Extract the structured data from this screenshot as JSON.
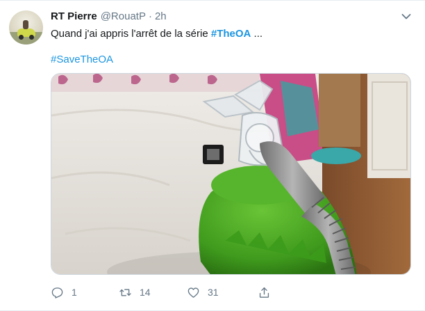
{
  "tweet": {
    "author_name": "RT Pierre",
    "author_handle": "@RouatP",
    "separator": "·",
    "timestamp": "2h",
    "text_before": "Quand j'ai appris l'arrêt de la série ",
    "hashtag_inline": "#TheOA",
    "text_after": " ...",
    "hashtag_line": "#SaveTheOA",
    "media_alt": "",
    "actions": {
      "reply_count": "1",
      "retweet_count": "14",
      "like_count": "31"
    }
  },
  "icons": {
    "menu": "chevron-down-icon",
    "reply": "reply-icon",
    "retweet": "retweet-icon",
    "like": "heart-icon",
    "share": "share-icon"
  },
  "colors": {
    "accent": "#1b95e0",
    "muted": "#657786",
    "text": "#14171a",
    "border": "#e6ecf0"
  }
}
